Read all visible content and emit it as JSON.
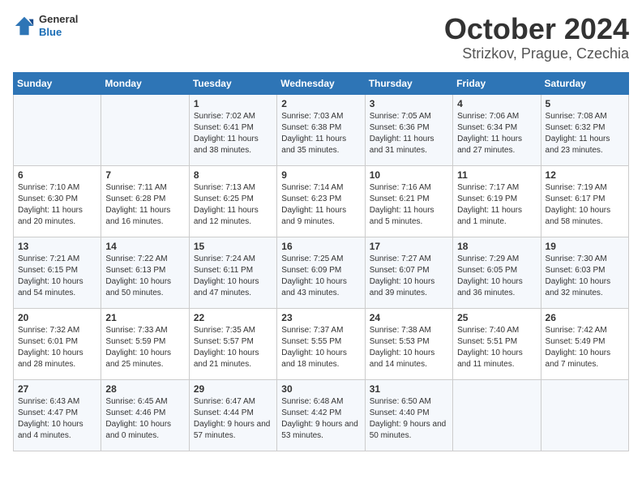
{
  "header": {
    "logo": {
      "general": "General",
      "blue": "Blue"
    },
    "title": "October 2024",
    "subtitle": "Strizkov, Prague, Czechia"
  },
  "days_of_week": [
    "Sunday",
    "Monday",
    "Tuesday",
    "Wednesday",
    "Thursday",
    "Friday",
    "Saturday"
  ],
  "weeks": [
    [
      {
        "day": "",
        "content": ""
      },
      {
        "day": "",
        "content": ""
      },
      {
        "day": "1",
        "content": "Sunrise: 7:02 AM\nSunset: 6:41 PM\nDaylight: 11 hours and 38 minutes."
      },
      {
        "day": "2",
        "content": "Sunrise: 7:03 AM\nSunset: 6:38 PM\nDaylight: 11 hours and 35 minutes."
      },
      {
        "day": "3",
        "content": "Sunrise: 7:05 AM\nSunset: 6:36 PM\nDaylight: 11 hours and 31 minutes."
      },
      {
        "day": "4",
        "content": "Sunrise: 7:06 AM\nSunset: 6:34 PM\nDaylight: 11 hours and 27 minutes."
      },
      {
        "day": "5",
        "content": "Sunrise: 7:08 AM\nSunset: 6:32 PM\nDaylight: 11 hours and 23 minutes."
      }
    ],
    [
      {
        "day": "6",
        "content": "Sunrise: 7:10 AM\nSunset: 6:30 PM\nDaylight: 11 hours and 20 minutes."
      },
      {
        "day": "7",
        "content": "Sunrise: 7:11 AM\nSunset: 6:28 PM\nDaylight: 11 hours and 16 minutes."
      },
      {
        "day": "8",
        "content": "Sunrise: 7:13 AM\nSunset: 6:25 PM\nDaylight: 11 hours and 12 minutes."
      },
      {
        "day": "9",
        "content": "Sunrise: 7:14 AM\nSunset: 6:23 PM\nDaylight: 11 hours and 9 minutes."
      },
      {
        "day": "10",
        "content": "Sunrise: 7:16 AM\nSunset: 6:21 PM\nDaylight: 11 hours and 5 minutes."
      },
      {
        "day": "11",
        "content": "Sunrise: 7:17 AM\nSunset: 6:19 PM\nDaylight: 11 hours and 1 minute."
      },
      {
        "day": "12",
        "content": "Sunrise: 7:19 AM\nSunset: 6:17 PM\nDaylight: 10 hours and 58 minutes."
      }
    ],
    [
      {
        "day": "13",
        "content": "Sunrise: 7:21 AM\nSunset: 6:15 PM\nDaylight: 10 hours and 54 minutes."
      },
      {
        "day": "14",
        "content": "Sunrise: 7:22 AM\nSunset: 6:13 PM\nDaylight: 10 hours and 50 minutes."
      },
      {
        "day": "15",
        "content": "Sunrise: 7:24 AM\nSunset: 6:11 PM\nDaylight: 10 hours and 47 minutes."
      },
      {
        "day": "16",
        "content": "Sunrise: 7:25 AM\nSunset: 6:09 PM\nDaylight: 10 hours and 43 minutes."
      },
      {
        "day": "17",
        "content": "Sunrise: 7:27 AM\nSunset: 6:07 PM\nDaylight: 10 hours and 39 minutes."
      },
      {
        "day": "18",
        "content": "Sunrise: 7:29 AM\nSunset: 6:05 PM\nDaylight: 10 hours and 36 minutes."
      },
      {
        "day": "19",
        "content": "Sunrise: 7:30 AM\nSunset: 6:03 PM\nDaylight: 10 hours and 32 minutes."
      }
    ],
    [
      {
        "day": "20",
        "content": "Sunrise: 7:32 AM\nSunset: 6:01 PM\nDaylight: 10 hours and 28 minutes."
      },
      {
        "day": "21",
        "content": "Sunrise: 7:33 AM\nSunset: 5:59 PM\nDaylight: 10 hours and 25 minutes."
      },
      {
        "day": "22",
        "content": "Sunrise: 7:35 AM\nSunset: 5:57 PM\nDaylight: 10 hours and 21 minutes."
      },
      {
        "day": "23",
        "content": "Sunrise: 7:37 AM\nSunset: 5:55 PM\nDaylight: 10 hours and 18 minutes."
      },
      {
        "day": "24",
        "content": "Sunrise: 7:38 AM\nSunset: 5:53 PM\nDaylight: 10 hours and 14 minutes."
      },
      {
        "day": "25",
        "content": "Sunrise: 7:40 AM\nSunset: 5:51 PM\nDaylight: 10 hours and 11 minutes."
      },
      {
        "day": "26",
        "content": "Sunrise: 7:42 AM\nSunset: 5:49 PM\nDaylight: 10 hours and 7 minutes."
      }
    ],
    [
      {
        "day": "27",
        "content": "Sunrise: 6:43 AM\nSunset: 4:47 PM\nDaylight: 10 hours and 4 minutes."
      },
      {
        "day": "28",
        "content": "Sunrise: 6:45 AM\nSunset: 4:46 PM\nDaylight: 10 hours and 0 minutes."
      },
      {
        "day": "29",
        "content": "Sunrise: 6:47 AM\nSunset: 4:44 PM\nDaylight: 9 hours and 57 minutes."
      },
      {
        "day": "30",
        "content": "Sunrise: 6:48 AM\nSunset: 4:42 PM\nDaylight: 9 hours and 53 minutes."
      },
      {
        "day": "31",
        "content": "Sunrise: 6:50 AM\nSunset: 4:40 PM\nDaylight: 9 hours and 50 minutes."
      },
      {
        "day": "",
        "content": ""
      },
      {
        "day": "",
        "content": ""
      }
    ]
  ]
}
